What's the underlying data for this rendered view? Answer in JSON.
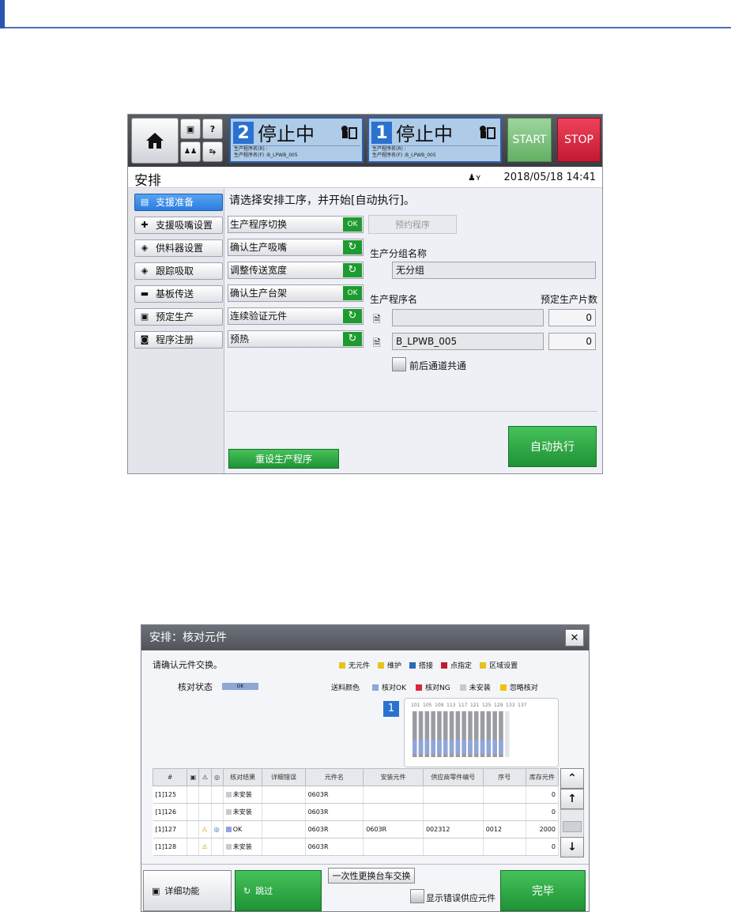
{
  "screen1": {
    "status1": {
      "num": "2",
      "text": "停止中",
      "line1": "生产程序名(R) :",
      "line2": "生产程序名(F) :B_LPWB_005"
    },
    "status2": {
      "num": "1",
      "text": "停止中",
      "line1": "生产程序名(R) :",
      "line2": "生产程序名(F) :B_LPWB_005"
    },
    "start": "START",
    "stop": "STOP",
    "title": "安排",
    "datetime": "2018/05/18 14:41",
    "sidebar": [
      {
        "label": "支援准备",
        "icon": "support-prep-icon",
        "glyph": "▤",
        "active": true
      },
      {
        "label": "支援吸嘴设置",
        "icon": "nozzle-setting-icon",
        "glyph": "✚",
        "active": false
      },
      {
        "label": "供料器设置",
        "icon": "feeder-setting-icon",
        "glyph": "◈",
        "active": false
      },
      {
        "label": "跟踪吸取",
        "icon": "track-pickup-icon",
        "glyph": "◈",
        "active": false
      },
      {
        "label": "基板传送",
        "icon": "board-transfer-icon",
        "glyph": "▬",
        "active": false
      },
      {
        "label": "预定生产",
        "icon": "planned-production-icon",
        "glyph": "▣",
        "active": false
      },
      {
        "label": "程序注册",
        "icon": "program-register-icon",
        "glyph": "◙",
        "active": false
      }
    ],
    "prompt": "请选择安排工序，并开始[自动执行]。",
    "steps": [
      {
        "label": "生产程序切换",
        "status": "OK"
      },
      {
        "label": "确认生产吸嘴",
        "status": "skip"
      },
      {
        "label": "调整传送宽度",
        "status": "skip"
      },
      {
        "label": "确认生产台架",
        "status": "OK"
      },
      {
        "label": "连续验证元件",
        "status": "skip"
      },
      {
        "label": "预热",
        "status": "skip"
      }
    ],
    "reserve_button": "预约程序",
    "group_label": "生产分组名称",
    "group_value": "无分组",
    "program_label": "生产程序名",
    "planned_label": "预定生产片数",
    "program1": "",
    "program1_count": "0",
    "program2": "B_LPWB_005",
    "program2_count": "0",
    "shared_label": "前后通道共通",
    "reset_button": "重设生产程序",
    "auto_button": "自动执行"
  },
  "screen2": {
    "title": "安排：核对元件",
    "message": "请确认元件交换。",
    "status_label": "核对状态",
    "status_value": "OK",
    "legend1": [
      {
        "label": "无元件",
        "color": "#e8c21a"
      },
      {
        "label": "维护",
        "color": "#e8c21a"
      },
      {
        "label": "搭接",
        "color": "#2a6ab8"
      },
      {
        "label": "点指定",
        "color": "#c21a33"
      },
      {
        "label": "区域设置",
        "color": "#e8c21a"
      }
    ],
    "feed_label": "送料颜色",
    "legend2": [
      {
        "label": "核对OK",
        "color": "#8fa6d8"
      },
      {
        "label": "核对NG",
        "color": "#d8283a"
      },
      {
        "label": "未安装",
        "color": "#c8c9cc"
      },
      {
        "label": "忽略核对",
        "color": "#f2c20a"
      }
    ],
    "lane": "1",
    "slot_labels": [
      "101",
      "105",
      "109",
      "113",
      "117",
      "121",
      "125",
      "129",
      "133",
      "137"
    ],
    "columns": [
      "#",
      "",
      "",
      "",
      "核对结果",
      "详细错误",
      "元件名",
      "安装元件",
      "供应商零件编号",
      "序号",
      "库存元件"
    ],
    "rows": [
      {
        "id": "[1]125",
        "warn": "",
        "splice": "",
        "result": "未安装",
        "result_color": "#c8c9cc",
        "detail": "",
        "part": "0603R",
        "mounted": "",
        "vendor": "",
        "serial": "",
        "stock": "0"
      },
      {
        "id": "[1]126",
        "warn": "",
        "splice": "",
        "result": "未安装",
        "result_color": "#c8c9cc",
        "detail": "",
        "part": "0603R",
        "mounted": "",
        "vendor": "",
        "serial": "",
        "stock": "0"
      },
      {
        "id": "[1]127",
        "warn": "⚠",
        "splice": "◎",
        "result": "OK",
        "result_color": "#8fa6d8",
        "detail": "",
        "part": "0603R",
        "mounted": "0603R",
        "vendor": "002312",
        "serial": "0012",
        "stock": "2000"
      },
      {
        "id": "[1]128",
        "warn": "⚠",
        "splice": "",
        "result": "未安装",
        "result_color": "#c8c9cc",
        "detail": "",
        "part": "0603R",
        "mounted": "",
        "vendor": "",
        "serial": "",
        "stock": "0"
      }
    ],
    "detail_button": "详细功能",
    "skip_button": "跳过",
    "swap_button": "一次性更换台车交换",
    "show_error_label": "显示错误供应元件",
    "done_button": "完毕"
  }
}
